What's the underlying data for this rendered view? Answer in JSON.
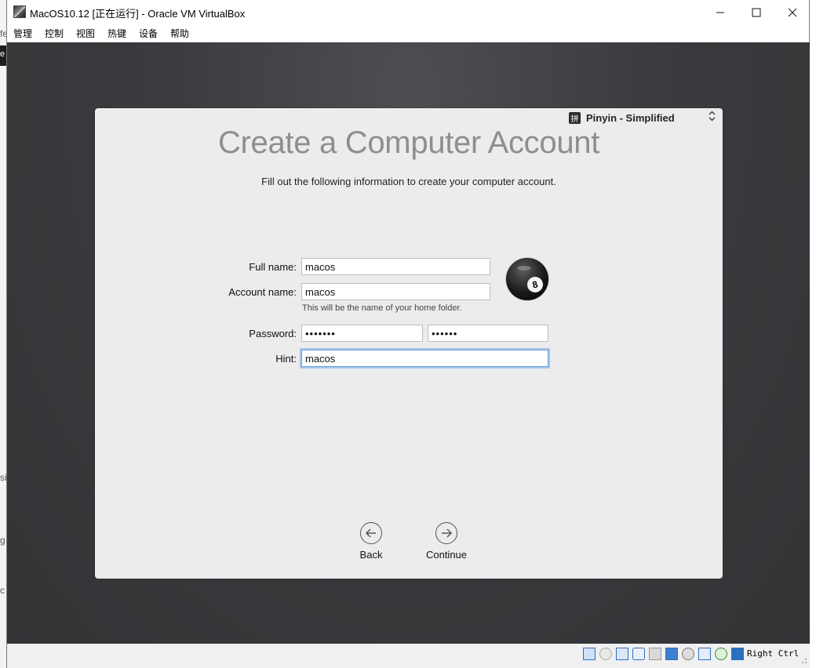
{
  "window": {
    "title": "MacOS10.12 [正在运行] - Oracle VM VirtualBox",
    "minimize_icon": "minimize-icon",
    "maximize_icon": "maximize-icon",
    "close_icon": "close-icon"
  },
  "menubar": {
    "items": [
      "管理",
      "控制",
      "视图",
      "热键",
      "设备",
      "帮助"
    ]
  },
  "background_fragments": [
    "fe",
    "e",
    "si",
    "g",
    "c"
  ],
  "setup": {
    "input_source": "Pinyin - Simplified",
    "input_source_glyph": "拼",
    "heading": "Create a Computer Account",
    "subtitle": "Fill out the following information to create your computer account.",
    "full_name_label": "Full name:",
    "full_name_value": "macos",
    "account_name_label": "Account name:",
    "account_name_value": "macos",
    "account_name_note": "This will be the name of your home folder.",
    "password_label": "Password:",
    "password_value": "•••••••",
    "verify_value": "••••••",
    "hint_label": "Hint:",
    "hint_value": "macos",
    "avatar_ball_number": "8",
    "back_label": "Back",
    "continue_label": "Continue"
  },
  "statusbar": {
    "host_key": "Right Ctrl",
    "icons": [
      "hard-disk-icon",
      "optical-drive-icon",
      "network-icon",
      "usb-icon",
      "shared-folder-icon",
      "display-icon",
      "video-capture-icon",
      "mouse-integration-icon",
      "recording-icon",
      "host-key-arrow-icon"
    ]
  },
  "colors": {
    "vm_background": "#3a3b3e",
    "panel": "#ececec",
    "focus_ring": "#a6c6f0"
  }
}
